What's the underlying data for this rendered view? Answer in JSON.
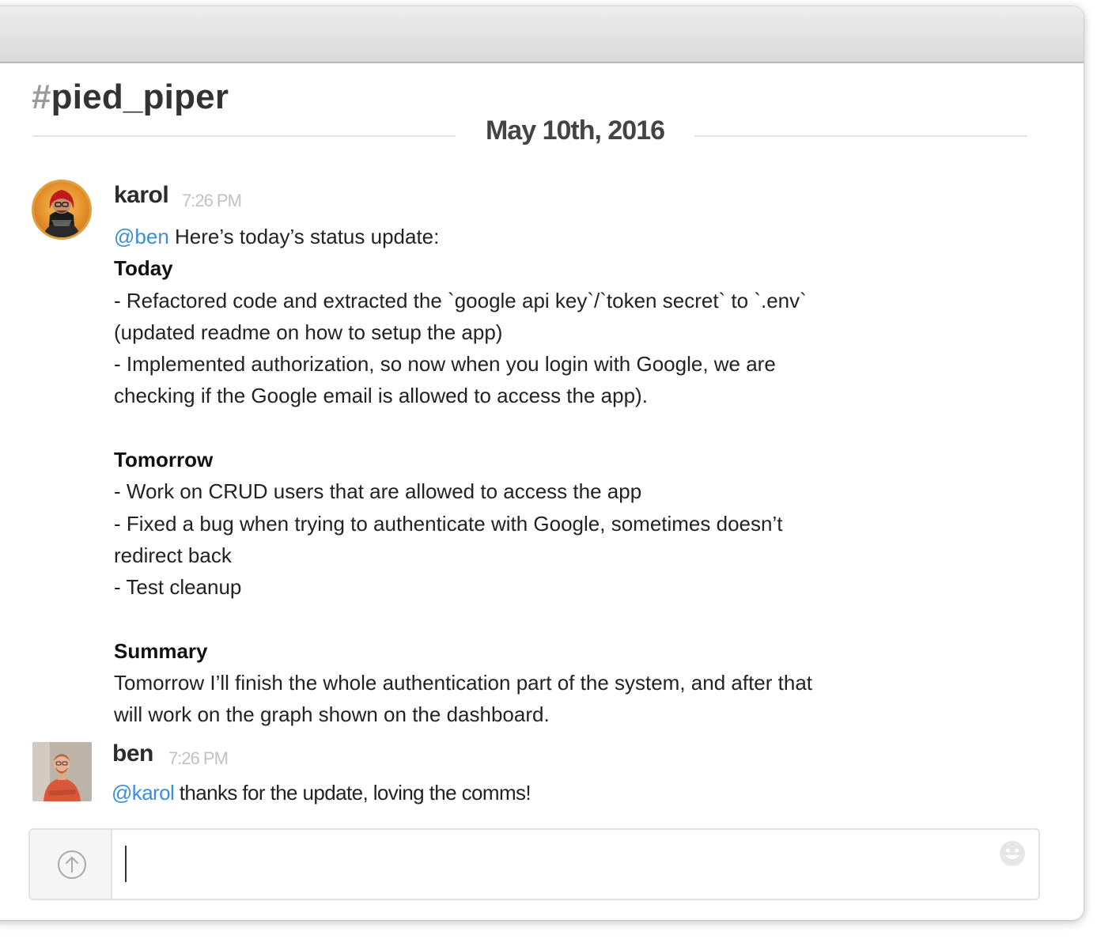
{
  "channel": {
    "hash": "#",
    "name": "pied_piper"
  },
  "date_divider": "May 10th, 2016",
  "messages": [
    {
      "sender": "karol",
      "time": "7:26 PM",
      "avatar": "karol-avatar",
      "lines": [
        {
          "mention": "@ben",
          "text": " Here’s today’s status update:"
        },
        {
          "bold": "Today"
        },
        {
          "text": "- Refactored code and extracted the `google api key`/`token secret` to `.env`"
        },
        {
          "text": "(updated readme on how to setup the app)"
        },
        {
          "text": "- Implemented authorization, so now when you login with Google, we are"
        },
        {
          "text": "checking if the Google email is allowed to access the app)."
        },
        {
          "text": ""
        },
        {
          "bold": "Tomorrow"
        },
        {
          "text": "- Work on CRUD users that are allowed to access the app"
        },
        {
          "text": "- Fixed a bug when trying to authenticate with Google, sometimes doesn’t"
        },
        {
          "text": "redirect back"
        },
        {
          "text": "- Test cleanup"
        },
        {
          "text": ""
        },
        {
          "bold": "Summary"
        },
        {
          "text": "Tomorrow I’ll finish the whole authentication part of the system, and after that"
        },
        {
          "text": "will work on the graph shown on the dashboard."
        }
      ]
    },
    {
      "sender": "ben",
      "time": "7:26 PM",
      "avatar": "ben-avatar",
      "lines": [
        {
          "mention": "@karol",
          "text": " thanks for the update, loving the comms!"
        }
      ]
    }
  ],
  "composer": {
    "value": "",
    "upload_icon": "upload-arrow-icon",
    "emoji_icon": "emoji-smiley-icon"
  },
  "colors": {
    "mention": "#3b8fd9",
    "timestamp": "#c2c2c2",
    "title": "#333333",
    "hash": "#9a9a9a"
  }
}
